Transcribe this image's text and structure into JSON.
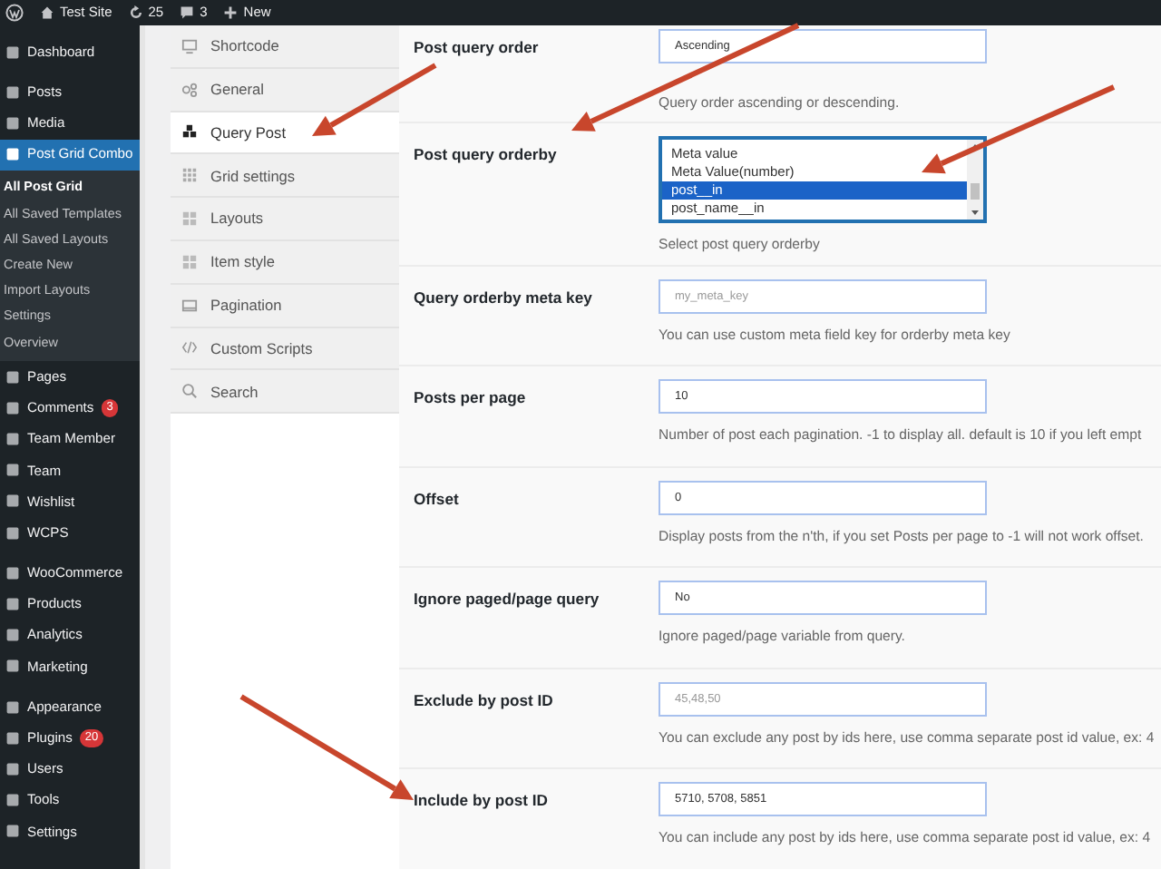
{
  "admin_bar": {
    "site": "Test Site",
    "updates": "25",
    "comments": "3",
    "new": "New"
  },
  "sidebar": {
    "groups": [
      {
        "items": [
          {
            "label": "Dashboard",
            "selected": false
          }
        ]
      },
      {
        "items": [
          {
            "label": "Posts",
            "selected": false
          },
          {
            "label": "Media",
            "selected": false
          },
          {
            "label": "Post Grid Combo",
            "selected": true,
            "children": [
              {
                "label": "All Post Grid",
                "selected": true
              },
              {
                "label": "All Saved Templates",
                "selected": false
              },
              {
                "label": "All Saved Layouts",
                "selected": false
              },
              {
                "label": "Create New",
                "selected": false
              },
              {
                "label": "Import Layouts",
                "selected": false
              },
              {
                "label": "Settings",
                "selected": false
              },
              {
                "label": "Overview",
                "selected": false
              }
            ]
          },
          {
            "label": "Pages",
            "selected": false
          },
          {
            "label": "Comments",
            "selected": false,
            "badge": "3"
          },
          {
            "label": "Team Member",
            "selected": false
          },
          {
            "label": "Team",
            "selected": false
          },
          {
            "label": "Wishlist",
            "selected": false
          },
          {
            "label": "WCPS",
            "selected": false
          }
        ]
      },
      {
        "items": [
          {
            "label": "WooCommerce",
            "selected": false
          },
          {
            "label": "Products",
            "selected": false
          },
          {
            "label": "Analytics",
            "selected": false
          },
          {
            "label": "Marketing",
            "selected": false
          }
        ]
      },
      {
        "items": [
          {
            "label": "Appearance",
            "selected": false
          },
          {
            "label": "Plugins",
            "selected": false,
            "badge": "20"
          },
          {
            "label": "Users",
            "selected": false
          },
          {
            "label": "Tools",
            "selected": false
          },
          {
            "label": "Settings",
            "selected": false
          }
        ]
      }
    ]
  },
  "tabs": [
    {
      "label": "Shortcode",
      "selected": false
    },
    {
      "label": "General",
      "selected": false
    },
    {
      "label": "Query Post",
      "selected": true
    },
    {
      "label": "Grid settings",
      "selected": false
    },
    {
      "label": "Layouts",
      "selected": false
    },
    {
      "label": "Item style",
      "selected": false
    },
    {
      "label": "Pagination",
      "selected": false
    },
    {
      "label": "Custom Scripts",
      "selected": false
    },
    {
      "label": "Search",
      "selected": false
    }
  ],
  "fields": [
    {
      "kind": "input",
      "label": "Post query order",
      "value": "Ascending",
      "description": "Query order ascending or descending."
    },
    {
      "kind": "listbox",
      "label": "Post query orderby",
      "options": [
        {
          "label": "Meta value",
          "selected": false
        },
        {
          "label": "Meta Value(number)",
          "selected": false
        },
        {
          "label": "post__in",
          "selected": true
        },
        {
          "label": "post_name__in",
          "selected": false
        }
      ],
      "description": "Select post query orderby"
    },
    {
      "kind": "input",
      "label": "Query orderby meta key",
      "placeholder": "my_meta_key",
      "description": "You can use custom meta field key for orderby meta key"
    },
    {
      "kind": "input",
      "label": "Posts per page",
      "value": "10",
      "description": "Number of post each pagination. -1 to display all. default is 10 if you left empt"
    },
    {
      "kind": "input",
      "label": "Offset",
      "value": "0",
      "description": "Display posts from the n'th, if you set Posts per page to -1 will not work offset."
    },
    {
      "kind": "input",
      "label": "Ignore paged/page query",
      "value": "No",
      "description": "Ignore paged/page variable from query."
    },
    {
      "kind": "input",
      "label": "Exclude by post ID",
      "placeholder": "45,48,50",
      "description": "You can exclude any post by ids here, use comma separate post id value, ex: 4"
    },
    {
      "kind": "input",
      "label": "Include by post ID",
      "value": "5710, 5708, 5851",
      "description": "You can include any post by ids here, use comma separate post id value, ex: 4"
    }
  ]
}
